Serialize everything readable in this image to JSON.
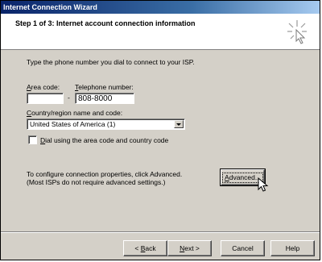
{
  "window": {
    "title": "Internet Connection Wizard"
  },
  "header": {
    "title": "Step 1 of 3: Internet account connection information",
    "icon": "wizard-wand-icon"
  },
  "form": {
    "instructions": "Type the phone number you dial to connect to your ISP.",
    "area_code": {
      "label_prefix": "",
      "label_access": "A",
      "label_rest": "rea code:",
      "value": ""
    },
    "dash": "-",
    "telephone": {
      "label_access": "T",
      "label_rest": "elephone number:",
      "value": "808-8000"
    },
    "country": {
      "label_access": "C",
      "label_rest": "ountry/region name and code:",
      "selected": "United States of America (1)"
    },
    "dial_checkbox": {
      "label_access": "D",
      "label_rest": "ial using the area code and country code",
      "checked": false
    },
    "advanced_text_line1": "To configure connection properties, click Advanced.",
    "advanced_text_line2": "(Most ISPs do not require advanced settings.)",
    "advanced_button": {
      "label_access": "A",
      "label_rest": "dvanced..."
    }
  },
  "footer": {
    "back": {
      "prefix": "< ",
      "access": "B",
      "rest": "ack"
    },
    "next": {
      "access": "N",
      "rest": "ext >"
    },
    "cancel": "Cancel",
    "help": "Help"
  }
}
